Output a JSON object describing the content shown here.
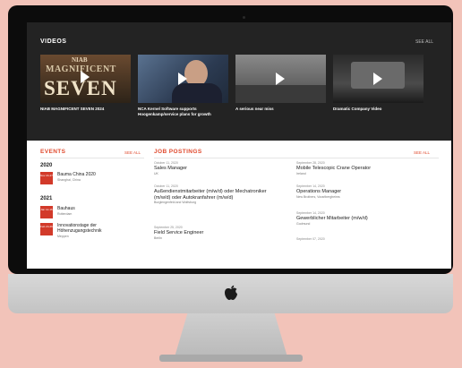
{
  "videos": {
    "title": "VIDEOS",
    "see_all": "SEE ALL",
    "items": [
      {
        "caption": "NIAB MAGNIFICENT SEVEN 2024",
        "thumb_text": [
          "NIAB",
          "MAGNIFICENT",
          "SEVEN"
        ]
      },
      {
        "caption": "NCA Kernel Software supports Hoogenkamp/service plans for growth"
      },
      {
        "caption": "A serious near miss"
      },
      {
        "caption": "Dramatic Company Video"
      }
    ]
  },
  "events": {
    "title": "EVENTS",
    "see_all": "SEE ALL",
    "years": [
      {
        "year": "2020",
        "items": [
          {
            "date": "Nov 24-27",
            "name": "Bauma China 2020",
            "location": "Shanghai, China"
          }
        ]
      },
      {
        "year": "2021",
        "items": [
          {
            "date": "Jan 12-16",
            "name": "Bauhaus",
            "location": "Rotterdam"
          },
          {
            "date": "Feb 24-26",
            "name": "Innovationstage der Höhenzugangstechnik",
            "location": "Meppen"
          }
        ]
      }
    ]
  },
  "jobs": {
    "title": "JOB POSTINGS",
    "see_all": "SEE ALL",
    "left": [
      {
        "date": "October 11, 2020",
        "title": "Sales Manager",
        "location": "UK"
      },
      {
        "date": "October 11, 2020",
        "title": "Außendienstmitarbeiter (m/w/d) oder Mechatroniker (m/w/d) oder Autokranfahrer (m/w/d)",
        "location": "Burglengenfeld and Wolfsburg"
      },
      {
        "date": "September 25, 2020",
        "title": "Field Service Engineer",
        "location": "Berlin"
      }
    ],
    "right": [
      {
        "date": "September 28, 2020",
        "title": "Mobile Telescopic Crane Operator",
        "location": "Ireland"
      },
      {
        "date": "September 14, 2020",
        "title": "Operations Manager",
        "location": "New Brothers, Vorarlbergheims"
      },
      {
        "date": "September 14, 2020",
        "title": "Gewerblicher Mitarbeiter (m/w/d)",
        "location": "Godmund"
      },
      {
        "date": "September 07, 2020",
        "title": "",
        "location": ""
      }
    ]
  },
  "colors": {
    "accent": "#e04a2e",
    "videos_band": "#232323",
    "background": "#f2c3b9"
  }
}
